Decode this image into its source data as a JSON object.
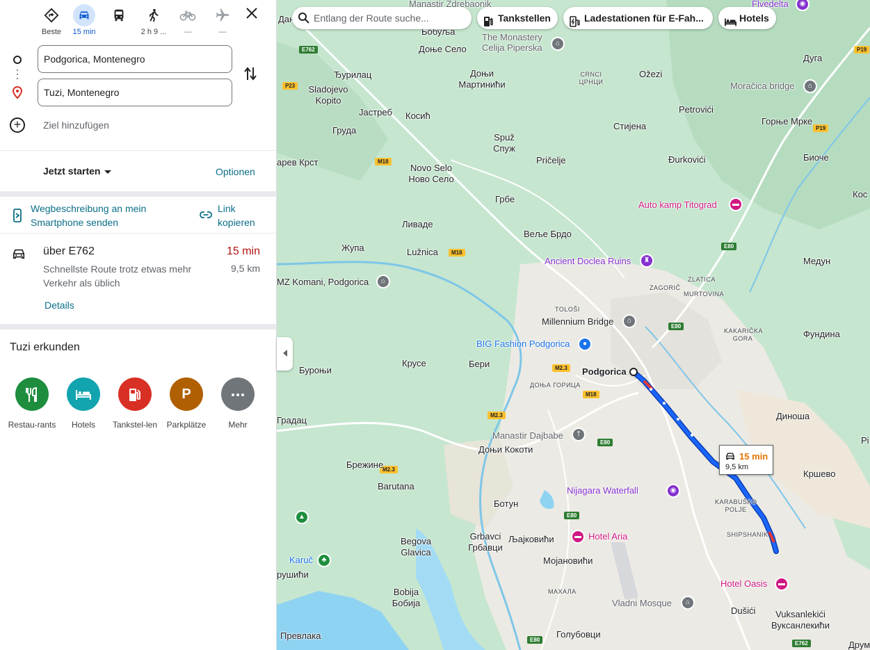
{
  "modes": [
    {
      "name": "best",
      "label": "Beste"
    },
    {
      "name": "driving",
      "label": "15 min"
    },
    {
      "name": "transit",
      "label": ""
    },
    {
      "name": "walking",
      "label": "2 h 9 ..."
    },
    {
      "name": "cycling",
      "label": "—"
    },
    {
      "name": "flights",
      "label": "—"
    }
  ],
  "origin": "Podgorica, Montenegro",
  "destination": "Tuzi, Montenegro",
  "add_destination": "Ziel hinzufügen",
  "timing": "Jetzt starten",
  "options": "Optionen",
  "send_to_phone": "Wegbeschreibung an mein Smartphone senden",
  "copy_link": "Link kopieren",
  "route": {
    "via": "über E762",
    "duration": "15 min",
    "distance": "9,5 km",
    "description": "Schnellste Route trotz etwas mehr Verkehr als üblich",
    "details": "Details"
  },
  "explore": {
    "title": "Tuzi erkunden",
    "categories": [
      {
        "label": "Restau-rants",
        "color": "#1e8e3e",
        "icon": "fork-knife-icon"
      },
      {
        "label": "Hotels",
        "color": "#12a4af",
        "icon": "bed-icon"
      },
      {
        "label": "Tankstel-len",
        "color": "#d93025",
        "icon": "fuel-icon"
      },
      {
        "label": "Parkplätze",
        "color": "#b06000",
        "icon": "parking-icon"
      },
      {
        "label": "Mehr",
        "color": "#70757a",
        "icon": "more-icon"
      }
    ]
  },
  "map": {
    "search_placeholder": "Entlang der Route suche...",
    "chips": [
      "Tankstellen",
      "Ladestationen für E-Fah...",
      "Hotels"
    ],
    "badge_duration": "15 min",
    "badge_distance": "9,5 km",
    "labels": {
      "danilovgrad": "Даниловград",
      "dobuja": "Бобуља",
      "donje_selo": "Доње Село",
      "monastery": "The Monastery Celija Piperska",
      "flvedelta": "Flvedelta",
      "duga": "Дуга",
      "djurilac": "Ђурилац",
      "donji_martinici": "Доњи Мартинићи",
      "sladojevo": "Sladojevo Kopito",
      "crnci": "CRNCI ЦРНЦИ",
      "ozezi": "Ožezi",
      "moracica": "Moračica bridge",
      "jastreb": "Јастреб",
      "kosic": "Косић",
      "gruda": "Груда",
      "petrovici": "Petrovići",
      "gornje_mrke": "Горње Мрке",
      "spuz": "Spuž Спуж",
      "stijena": "Стијена",
      "novo_selo": "Novo Selo Ново Село",
      "pricelje": "Pričelje",
      "djurkovici": "Đurkovići",
      "bioce": "Биоче",
      "carev_krst": "арев Крст",
      "grbe": "Грбе",
      "auto_kamp": "Auto kamp Titograd",
      "kosi": "Кос",
      "livade": "Ливаде",
      "velje_brdo": "Веље Брдо",
      "zupa": "Жупа",
      "luznica": "Lužnica",
      "doclea": "Ancient Doclea Ruins",
      "medun": "Медун",
      "komani": "MZ Komani, Podgorica",
      "zagoric": "ZAGORIČ",
      "zlatica": "ZLATICA",
      "murtovina": "MURTOVINA",
      "tolosi": "TOLOŠI",
      "millennium": "Millennium Bridge",
      "kakaricka": "KAKARIČKA GORA",
      "fundina": "Фундина",
      "big_fashion": "BIG Fashion Podgorica",
      "burojni": "Буроњи",
      "kruse": "Крусе",
      "beri": "Бери",
      "donja_gorica": "ДОЊА ГОРИЦА",
      "podgorica": "Podgorica",
      "gradac": "Градац",
      "dajbabe": "Manastir Dajbabe",
      "dinosa": "Диноша",
      "pi": "Pi",
      "donji_kokoti": "Доњи Кокоти",
      "brezine": "Брежине",
      "barutana": "Barutana",
      "krsevo": "Кршево",
      "nijagara": "Nijagara Waterfall",
      "botun": "Ботун",
      "karabusko": "KARABUŠKO POLJE",
      "grbavci": "Grbavci Грбавци",
      "ljajkovici": "Љајковићи",
      "hotel_aria": "Hotel Aria",
      "shipshanik": "SHIPSHANIK",
      "begova": "Begova Glavica",
      "mojanovici": "Мојановићи",
      "karuc": "Karuč",
      "rusici": "рушићи",
      "hotel_oasis": "Hotel Oasis",
      "mahala": "МАХАЛА",
      "bobija": "Bobija Бобија",
      "vladni": "Vladni Mosque",
      "dusici": "Dušići",
      "vuksanlekici": "Vuksanlekići Вуксанлекићи",
      "prevlaka": "Превлака",
      "golubovci": "Голубовци",
      "druma": "Друм",
      "m_zdrebaonik": "Manastir Zdrebaonik"
    },
    "shields": [
      "E762",
      "P23",
      "M18",
      "M18",
      "E80",
      "E80",
      "M2.3",
      "M18",
      "M2.3",
      "E80",
      "M2.3",
      "E80",
      "E80",
      "E762",
      "P19",
      "P19"
    ]
  }
}
